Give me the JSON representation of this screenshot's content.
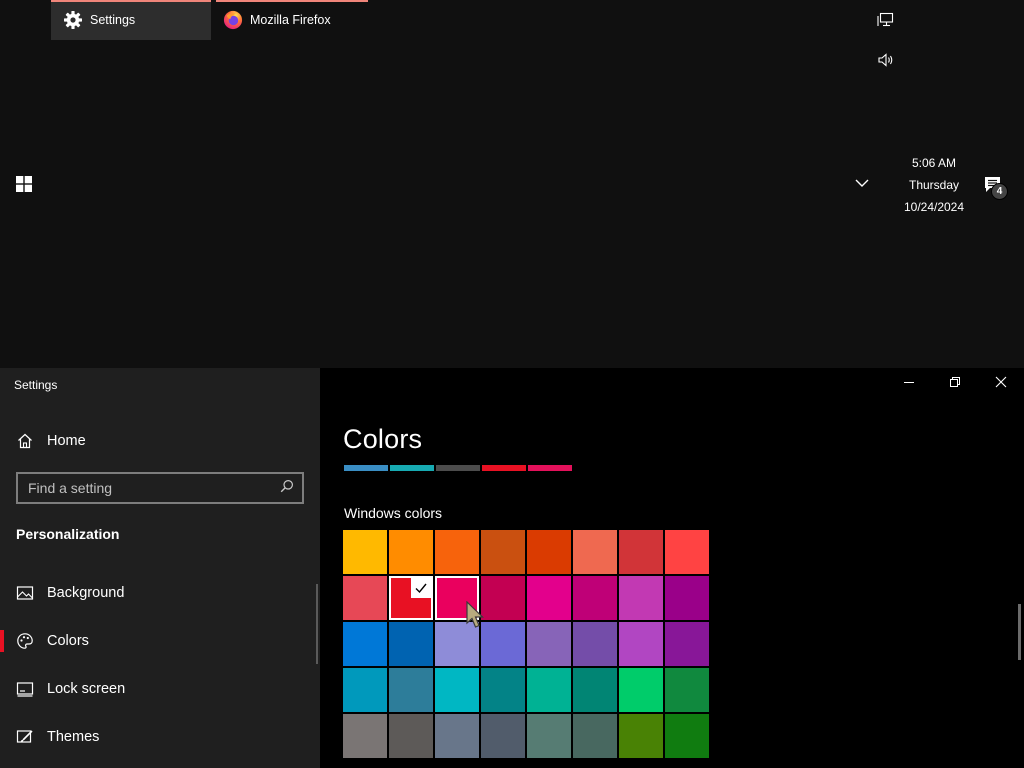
{
  "taskbar": {
    "apps": [
      {
        "label": "Settings",
        "icon": "gear-icon"
      },
      {
        "label": "Mozilla Firefox",
        "icon": "firefox-icon"
      }
    ],
    "clock": {
      "time": "5:06 AM",
      "day": "Thursday",
      "date": "10/24/2024"
    },
    "notification_count": "4"
  },
  "window": {
    "title": "Settings",
    "sidebar": {
      "home_label": "Home",
      "search_placeholder": "Find a setting",
      "section_heading": "Personalization",
      "items": [
        {
          "label": "Background",
          "icon": "image-icon"
        },
        {
          "label": "Colors",
          "icon": "palette-icon",
          "active": true
        },
        {
          "label": "Lock screen",
          "icon": "lock-screen-icon"
        },
        {
          "label": "Themes",
          "icon": "brush-icon"
        }
      ]
    },
    "main": {
      "page_title": "Colors",
      "recent_colors": [
        "#3a8ec4",
        "#17aab2",
        "#4c4c4c",
        "#e81123",
        "#e3115b"
      ],
      "windows_colors_label": "Windows colors",
      "swatches": [
        [
          "#ffb900",
          "#ff8c00",
          "#f7630c",
          "#ca5010",
          "#da3b01",
          "#ef6950",
          "#d13438",
          "#ff4343"
        ],
        [
          "#e74856",
          "#e81123",
          "#ea005e",
          "#c30052",
          "#e3008c",
          "#bf0077",
          "#c239b3",
          "#9a0089"
        ],
        [
          "#0078d7",
          "#0063b1",
          "#8e8cd8",
          "#6b69d6",
          "#8764b8",
          "#744da9",
          "#b146c2",
          "#881798"
        ],
        [
          "#0099bc",
          "#2d7d9a",
          "#00b7c3",
          "#038387",
          "#00b294",
          "#018574",
          "#00cc6a",
          "#10893e"
        ],
        [
          "#7a7574",
          "#5d5a58",
          "#68768a",
          "#515c6b",
          "#567c73",
          "#486860",
          "#498205",
          "#107c10"
        ]
      ],
      "selected_swatch": {
        "row": 1,
        "col": 1
      },
      "hover_swatch": {
        "row": 1,
        "col": 2
      }
    }
  },
  "colors": {
    "accent": "#e81123",
    "taskbar_bg": "#101010",
    "sidebar_bg": "#1f1f1f",
    "content_bg": "#000000"
  }
}
